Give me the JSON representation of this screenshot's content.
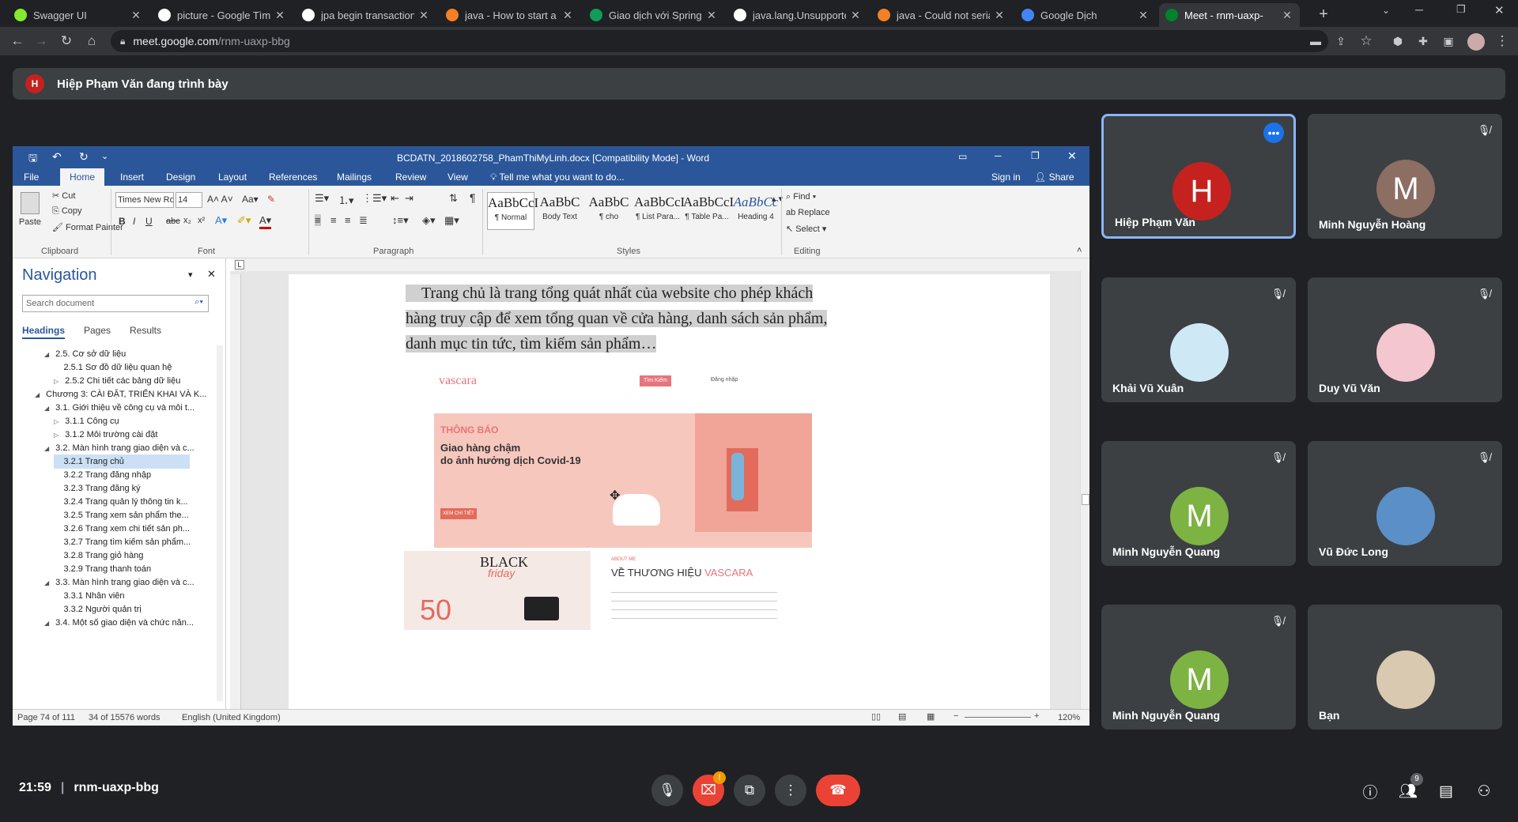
{
  "browser": {
    "tabs": [
      {
        "title": "Swagger UI",
        "icon": "swagger-icon",
        "color": "#85ea2d"
      },
      {
        "title": "picture - Google Tìm kiếm",
        "icon": "google-icon",
        "color": "#ffffff"
      },
      {
        "title": "jpa begin transaction",
        "icon": "google-icon",
        "color": "#ffffff"
      },
      {
        "title": "java - How to start a tr",
        "icon": "stackoverflow-icon",
        "color": "#f48024"
      },
      {
        "title": "Giao dịch với Spring và",
        "icon": "document-icon",
        "color": "#0f9d58"
      },
      {
        "title": "java.lang.Unsupported",
        "icon": "google-icon",
        "color": "#ffffff"
      },
      {
        "title": "java - Could not serial",
        "icon": "stackoverflow-icon",
        "color": "#f48024"
      },
      {
        "title": "Google Dịch",
        "icon": "translate-icon",
        "color": "#4285f4"
      },
      {
        "title": "Meet - rnm-uaxp-",
        "icon": "meet-icon",
        "color": "#00832d"
      }
    ],
    "url_host": "meet.google.com",
    "url_path": "/rnm-uaxp-bbg"
  },
  "meet": {
    "presenting_initial": "H",
    "presenting_text": "Hiệp Phạm Văn đang trình bày",
    "time": "21:59",
    "meeting_code": "rnm-uaxp-bbg",
    "people_count": "9",
    "participants": [
      {
        "name": "Hiệp Phạm Văn",
        "initial": "H",
        "avatar_color": "#c5221f",
        "muted": false,
        "active": true
      },
      {
        "name": "Minh Nguyễn Hoàng",
        "initial": "M",
        "avatar_color": "#8d6e63",
        "muted": true,
        "active": false
      },
      {
        "name": "Khải Vũ Xuân",
        "initial": "",
        "avatar_color": "#cfe8f5",
        "muted": true,
        "active": false
      },
      {
        "name": "Duy Vũ Văn",
        "initial": "",
        "avatar_color": "#f4c6d0",
        "muted": true,
        "active": false
      },
      {
        "name": "Minh Nguyễn Quang",
        "initial": "M",
        "avatar_color": "#7cb342",
        "muted": true,
        "active": false
      },
      {
        "name": "Vũ Đức Long",
        "initial": "",
        "avatar_color": "#5b8fc7",
        "muted": true,
        "active": false
      },
      {
        "name": "Minh Nguyễn Quang",
        "initial": "M",
        "avatar_color": "#7cb342",
        "muted": true,
        "active": false
      },
      {
        "name": "Bạn",
        "initial": "",
        "avatar_color": "#d9c9b0",
        "muted": false,
        "active": false
      }
    ]
  },
  "word": {
    "title": "BCDATN_2018602758_PhamThiMyLinh.docx [Compatibility Mode] - Word",
    "menu_tabs": [
      "File",
      "Home",
      "Insert",
      "Design",
      "Layout",
      "References",
      "Mailings",
      "Review",
      "View"
    ],
    "tell_me": "Tell me what you want to do...",
    "sign_in": "Sign in",
    "share": "Share",
    "clipboard": {
      "paste": "Paste",
      "cut": "Cut",
      "copy": "Copy",
      "format_painter": "Format Painter",
      "label": "Clipboard"
    },
    "font": {
      "name": "Times New Ro",
      "size": "14",
      "label": "Font"
    },
    "paragraph_label": "Paragraph",
    "styles": [
      {
        "preview": "AaBbCcI",
        "name": "¶ Normal"
      },
      {
        "preview": "AaBbC",
        "name": "Body Text"
      },
      {
        "preview": "AaBbC",
        "name": "¶ cho"
      },
      {
        "preview": "AaBbCcI",
        "name": "¶ List Para..."
      },
      {
        "preview": "AaBbCcI",
        "name": "¶ Table Pa..."
      },
      {
        "preview": "AaBbCc",
        "name": "Heading 4"
      }
    ],
    "styles_label": "Styles",
    "editing": {
      "find": "Find",
      "replace": "Replace",
      "select": "Select",
      "label": "Editing"
    },
    "navigation": {
      "title": "Navigation",
      "search_placeholder": "Search document",
      "tabs": [
        "Headings",
        "Pages",
        "Results"
      ],
      "headings": [
        "2.5. Cơ sở dữ liệu",
        "2.5.1  Sơ đồ dữ liệu quan hệ",
        "2.5.2 Chi tiết các bảng dữ liệu",
        "Chương 3: CÀI ĐẶT, TRIỂN KHAI VÀ K...",
        "3.1. Giới thiệu về công cụ và môi t...",
        "3.1.1  Công cụ",
        "3.1.2  Môi trường cài đặt",
        "3.2. Màn hình trang giao diện và c...",
        "3.2.1 Trang chủ",
        "3.2.2 Trang đăng nhập",
        "3.2.3 Trang đăng ký",
        "3.2.4 Trang quản lý thông tin k...",
        "3.2.5  Trang xem sản phẩm the...",
        "3.2.6  Trang xem chi tiết sản ph...",
        "3.2.7  Trang tìm kiếm sản phẩm...",
        "3.2.8  Trang giỏ hàng",
        "3.2.9 Trang thanh toán",
        "3.3. Màn hình trang giao diện và c...",
        "3.3.1 Nhân viên",
        "3.3.2 Người quản trị",
        "3.4. Một số giao diện và chức năn..."
      ]
    },
    "doc_text_1": "Trang chủ là trang tổng quát nhất của website cho phép khách hàng truy cập để xem tổng quan về cửa hàng, danh sách sản phẩm, danh mục tin tức, tìm kiếm sản phẩm…",
    "website": {
      "brand": "vascara",
      "search_btn": "Tìm Kiếm",
      "login": "Đăng nhập",
      "notice_label": "THÔNG BÁO",
      "headline": "Giao hàng chậm",
      "headline2": "do ảnh hưởng dịch Covid-19",
      "cta": "XEM CHI TIẾT",
      "about_label": "ABOUT ME",
      "about_title_1": "VỀ THƯƠNG HIỆU ",
      "about_title_2": "VASCARA",
      "black": "BLACK",
      "friday": "friday",
      "sale": "50"
    },
    "status": {
      "page": "Page 74 of 111",
      "words": "34 of 15576 words",
      "language": "English (United Kingdom)",
      "zoom": "120%"
    }
  }
}
